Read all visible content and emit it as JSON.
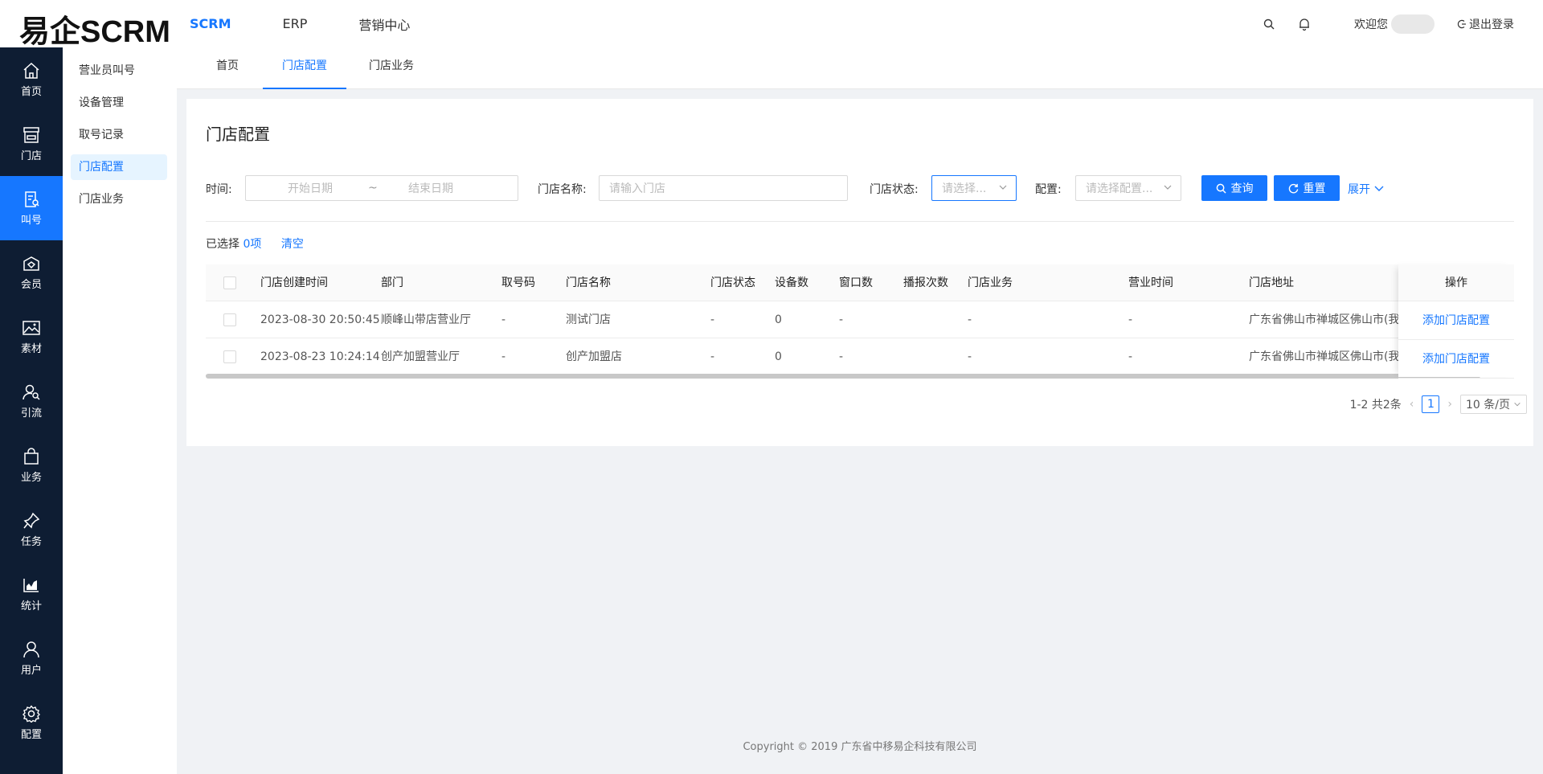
{
  "header": {
    "logo": "易企SCRM",
    "nav": [
      "SCRM",
      "ERP",
      "营销中心"
    ],
    "welcome": "欢迎您",
    "logout": "退出登录"
  },
  "sidebar": {
    "items": [
      {
        "label": "首页",
        "icon": "home-icon"
      },
      {
        "label": "门店",
        "icon": "store-icon"
      },
      {
        "label": "叫号",
        "icon": "queue-icon"
      },
      {
        "label": "会员",
        "icon": "member-icon"
      },
      {
        "label": "素材",
        "icon": "image-icon"
      },
      {
        "label": "引流",
        "icon": "user-search-icon"
      },
      {
        "label": "业务",
        "icon": "bag-icon"
      },
      {
        "label": "任务",
        "icon": "pin-icon"
      },
      {
        "label": "统计",
        "icon": "chart-icon"
      },
      {
        "label": "用户",
        "icon": "user-icon"
      },
      {
        "label": "配置",
        "icon": "gear-icon"
      }
    ]
  },
  "submenu": [
    "营业员叫号",
    "设备管理",
    "取号记录",
    "门店配置",
    "门店业务"
  ],
  "tabs": [
    "首页",
    "门店配置",
    "门店业务"
  ],
  "page": {
    "title": "门店配置",
    "filters": {
      "time_label": "时间:",
      "start_placeholder": "开始日期",
      "range_sep": "~",
      "end_placeholder": "结束日期",
      "store_name_label": "门店名称:",
      "store_name_placeholder": "请输入门店",
      "status_label": "门店状态:",
      "status_placeholder": "请选择...",
      "config_label": "配置:",
      "config_placeholder": "请选择配置...",
      "query_btn": "查询",
      "reset_btn": "重置",
      "expand": "展开"
    },
    "selection": {
      "prefix": "已选择",
      "count": "0项",
      "clear": "清空"
    },
    "table": {
      "columns": [
        "门店创建时间",
        "部门",
        "取号码",
        "门店名称",
        "门店状态",
        "设备数",
        "窗口数",
        "播报次数",
        "门店业务",
        "营业时间",
        "门店地址",
        "操作"
      ],
      "rows": [
        [
          "2023-08-30 20:50:45",
          "顺峰山带店营业厅",
          "-",
          "测试门店",
          "-",
          "0",
          "-",
          "",
          "-",
          "-",
          "广东省佛山市禅城区佛山市(我",
          "添加门店配置"
        ],
        [
          "2023-08-23 10:24:14",
          "创产加盟营业厅",
          "-",
          "创产加盟店",
          "-",
          "0",
          "-",
          "",
          "-",
          "-",
          "广东省佛山市禅城区佛山市(我",
          "添加门店配置"
        ]
      ]
    },
    "pagination": {
      "summary": "1-2 共2条",
      "current": "1",
      "page_size": "10 条/页"
    }
  },
  "footer": "Copyright © 2019 广东省中移易企科技有限公司",
  "colors": {
    "primary": "#1677ff",
    "sidebar": "#0e1d33",
    "background": "#f0f2f5"
  }
}
